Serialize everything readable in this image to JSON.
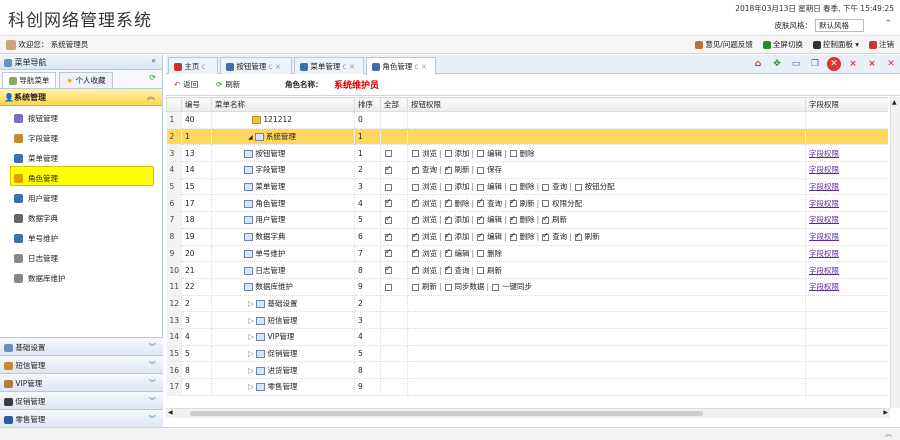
{
  "app": {
    "title": "科创网络管理系统",
    "datetime": "2018年03月13日  星期日  春季,  下午 15:49:25",
    "skin_label": "皮肤风格：",
    "skin_value": "默认风格"
  },
  "userbar": {
    "welcome": "欢迎您：  系统管理员",
    "tools": [
      "意见/问题反馈",
      "全屏切换",
      "控制面板 ▾",
      "注销"
    ]
  },
  "sidebar": {
    "title": "菜单导航",
    "tabs": [
      "导航菜单",
      "个人收藏"
    ],
    "group": "系统管理",
    "items": [
      "按钮管理",
      "字段管理",
      "菜单管理",
      "角色管理",
      "用户管理",
      "数据字典",
      "单号维护",
      "日志管理",
      "数据库维护"
    ],
    "accordions": [
      "基础设置",
      "短信管理",
      "VIP管理",
      "促销管理",
      "零售管理"
    ]
  },
  "tabs": [
    {
      "label": "主页",
      "close": "c"
    },
    {
      "label": "按钮管理",
      "close": "c ×"
    },
    {
      "label": "菜单管理",
      "close": "c ×"
    },
    {
      "label": "角色管理",
      "close": "c ×"
    }
  ],
  "toolbar": {
    "back": "返回",
    "refresh": "刷新",
    "role_label": "角色名称：",
    "role_name": "系统维护员"
  },
  "grid": {
    "headers": [
      "",
      "编号",
      "菜单名称",
      "排序",
      "全部",
      "按钮权限",
      "字段权限"
    ],
    "field_link": "字段权限",
    "rows": [
      {
        "n": "1",
        "id": "40",
        "name": "121212",
        "sort": "0",
        "all": "",
        "perms": [],
        "field": "",
        "indent": 1,
        "hi": false
      },
      {
        "n": "2",
        "id": "1",
        "name": "系统管理",
        "sort": "1",
        "all": "",
        "perms": [],
        "field": "",
        "indent": 0,
        "hi": true
      },
      {
        "n": "3",
        "id": "13",
        "name": "按钮管理",
        "sort": "1",
        "all": "0",
        "perms": [
          [
            "浏览",
            0
          ],
          [
            "添加",
            0
          ],
          [
            "编辑",
            0
          ],
          [
            "删除",
            0
          ]
        ],
        "field": "字段权限",
        "indent": 2,
        "hi": false
      },
      {
        "n": "4",
        "id": "14",
        "name": "字段管理",
        "sort": "2",
        "all": "1",
        "perms": [
          [
            "查询",
            1
          ],
          [
            "刷新",
            1
          ],
          [
            "保存",
            0
          ]
        ],
        "field": "字段权限",
        "indent": 2,
        "hi": false
      },
      {
        "n": "5",
        "id": "15",
        "name": "菜单管理",
        "sort": "3",
        "all": "0",
        "perms": [
          [
            "浏览",
            0
          ],
          [
            "添加",
            0
          ],
          [
            "编辑",
            0
          ],
          [
            "删除",
            0
          ],
          [
            "查询",
            0
          ],
          [
            "按钮分配",
            0
          ]
        ],
        "field": "字段权限",
        "indent": 2,
        "hi": false
      },
      {
        "n": "6",
        "id": "17",
        "name": "角色管理",
        "sort": "4",
        "all": "1",
        "perms": [
          [
            "浏览",
            1
          ],
          [
            "删除",
            1
          ],
          [
            "查询",
            1
          ],
          [
            "刷新",
            1
          ],
          [
            "权限分配",
            0
          ]
        ],
        "field": "字段权限",
        "indent": 2,
        "hi": false
      },
      {
        "n": "7",
        "id": "18",
        "name": "用户管理",
        "sort": "5",
        "all": "1",
        "perms": [
          [
            "浏览",
            1
          ],
          [
            "添加",
            1
          ],
          [
            "编辑",
            1
          ],
          [
            "删除",
            1
          ],
          [
            "刷新",
            1
          ]
        ],
        "field": "字段权限",
        "indent": 2,
        "hi": false
      },
      {
        "n": "8",
        "id": "19",
        "name": "数据字典",
        "sort": "6",
        "all": "1",
        "perms": [
          [
            "浏览",
            1
          ],
          [
            "添加",
            1
          ],
          [
            "编辑",
            1
          ],
          [
            "删除",
            1
          ],
          [
            "查询",
            1
          ],
          [
            "刷新",
            1
          ]
        ],
        "field": "字段权限",
        "indent": 2,
        "hi": false
      },
      {
        "n": "9",
        "id": "20",
        "name": "单号维护",
        "sort": "7",
        "all": "1",
        "perms": [
          [
            "浏览",
            1
          ],
          [
            "编辑",
            1
          ],
          [
            "删除",
            0
          ]
        ],
        "field": "字段权限",
        "indent": 2,
        "hi": false
      },
      {
        "n": "10",
        "id": "21",
        "name": "日志管理",
        "sort": "8",
        "all": "1",
        "perms": [
          [
            "浏览",
            1
          ],
          [
            "查询",
            1
          ],
          [
            "刷新",
            0
          ]
        ],
        "field": "字段权限",
        "indent": 2,
        "hi": false
      },
      {
        "n": "11",
        "id": "22",
        "name": "数据库维护",
        "sort": "9",
        "all": "0",
        "perms": [
          [
            "刷新",
            0
          ],
          [
            "同步数据",
            0
          ],
          [
            "一键同步",
            0
          ]
        ],
        "field": "字段权限",
        "indent": 2,
        "hi": false
      },
      {
        "n": "12",
        "id": "2",
        "name": "基础设置",
        "sort": "2",
        "all": "",
        "perms": [],
        "field": "",
        "indent": 0,
        "hi": false,
        "exp": "▷"
      },
      {
        "n": "13",
        "id": "3",
        "name": "短信管理",
        "sort": "3",
        "all": "",
        "perms": [],
        "field": "",
        "indent": 0,
        "hi": false,
        "exp": "▷"
      },
      {
        "n": "14",
        "id": "4",
        "name": "VIP管理",
        "sort": "4",
        "all": "",
        "perms": [],
        "field": "",
        "indent": 0,
        "hi": false,
        "exp": "▷"
      },
      {
        "n": "15",
        "id": "5",
        "name": "促销管理",
        "sort": "5",
        "all": "",
        "perms": [],
        "field": "",
        "indent": 0,
        "hi": false,
        "exp": "▷"
      },
      {
        "n": "16",
        "id": "8",
        "name": "进货管理",
        "sort": "8",
        "all": "",
        "perms": [],
        "field": "",
        "indent": 0,
        "hi": false,
        "exp": "▷"
      },
      {
        "n": "17",
        "id": "9",
        "name": "零售管理",
        "sort": "9",
        "all": "",
        "perms": [],
        "field": "",
        "indent": 0,
        "hi": false,
        "exp": "▷"
      }
    ]
  },
  "colors": {
    "highlight": "#ffd75e",
    "sidebar_selected": "#ffff00",
    "role_name": "#dd0000"
  }
}
